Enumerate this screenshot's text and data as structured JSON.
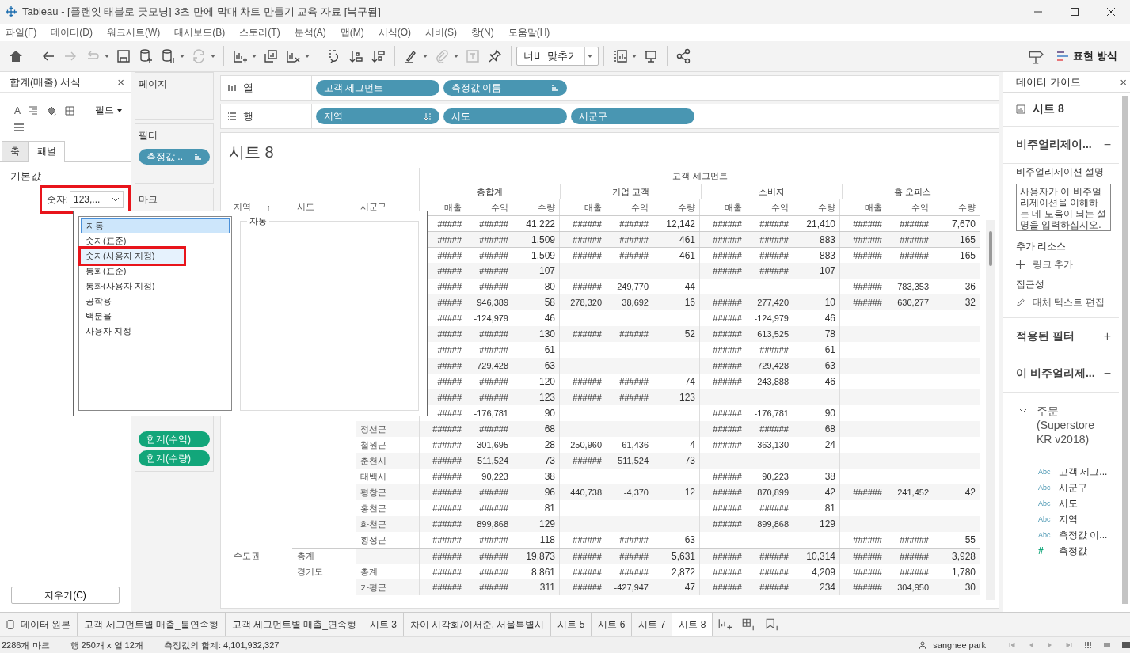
{
  "window": {
    "title": "Tableau - [플랜잇 태블로 굿모닝] 3초 만에 막대 차트 만들기 교육 자료 [복구됨]"
  },
  "menu": [
    "파일(F)",
    "데이터(D)",
    "워크시트(W)",
    "대시보드(B)",
    "스토리(T)",
    "분석(A)",
    "맵(M)",
    "서식(O)",
    "서버(S)",
    "창(N)",
    "도움말(H)"
  ],
  "toolbar": {
    "left": [
      {
        "disabled": false,
        "dropdown": false
      },
      {
        "disabled": false,
        "dropdown": false
      },
      {
        "disabled": true,
        "dropdown": false
      },
      {
        "disabled": true,
        "dropdown": true
      },
      {
        "disabled": false,
        "dropdown": false
      },
      {
        "disabled": false,
        "dropdown": false
      },
      {
        "disabled": false,
        "dropdown": true
      },
      {
        "disabled": true,
        "dropdown": true
      },
      {
        "disabled": false,
        "dropdown": true
      },
      {
        "disabled": false,
        "dropdown": false
      },
      {
        "disabled": false,
        "dropdown": true
      },
      {
        "disabled": false,
        "dropdown": false
      },
      {
        "disabled": false,
        "dropdown": false
      },
      {
        "disabled": false,
        "dropdown": false
      },
      {
        "disabled": false,
        "dropdown": true
      },
      {
        "disabled": true,
        "dropdown": true
      },
      {
        "disabled": true,
        "dropdown": false
      },
      {
        "disabled": false,
        "dropdown": false
      }
    ],
    "fit": "너비 맞추기",
    "right": [
      {
        "disabled": false,
        "dropdown": true
      },
      {
        "disabled": false,
        "dropdown": false
      },
      {
        "disabled": false,
        "dropdown": false
      }
    ],
    "show_me": "표현 방식"
  },
  "format_panel": {
    "title": "합계(매출) 서식",
    "close": "×",
    "font_glyph": "A",
    "field_menu": "필드",
    "tabs": [
      {
        "label": "축",
        "selected": false
      },
      {
        "label": "패널",
        "selected": true
      }
    ],
    "section": "기본값",
    "number_label": "숫자:",
    "number_value": "123,...",
    "number_highlighted": true,
    "clear_button": "지우기(C)"
  },
  "format_popup": {
    "options": [
      {
        "label": "자동",
        "selected": true,
        "hovered": false,
        "highlighted": false
      },
      {
        "label": "숫자(표준)",
        "selected": false,
        "hovered": false,
        "highlighted": false
      },
      {
        "label": "숫자(사용자 지정)",
        "selected": false,
        "hovered": true,
        "highlighted": true
      },
      {
        "label": "통화(표준)",
        "selected": false,
        "hovered": false,
        "highlighted": false
      },
      {
        "label": "통화(사용자 지정)",
        "selected": false,
        "hovered": false,
        "highlighted": false
      },
      {
        "label": "공학용",
        "selected": false,
        "hovered": false,
        "highlighted": false
      },
      {
        "label": "백분율",
        "selected": false,
        "hovered": false,
        "highlighted": false
      },
      {
        "label": "사용자 지정",
        "selected": false,
        "hovered": false,
        "highlighted": false
      }
    ],
    "group_label": "자동"
  },
  "cards": {
    "pages": "페이지",
    "filters": {
      "title": "필터",
      "pills": [
        {
          "label": "측정값 ..",
          "kind": "measure_names"
        }
      ]
    },
    "marks": {
      "title": "마크",
      "pills": [
        {
          "label": "합계(수익)",
          "kind": "measure"
        },
        {
          "label": "합계(수량)",
          "kind": "measure"
        }
      ]
    }
  },
  "shelves": {
    "columns": {
      "label": "열",
      "pills": [
        {
          "label": "고객 세그먼트",
          "kind": "dimension",
          "sorted": false
        },
        {
          "label": "측정값 이름",
          "kind": "measure_names",
          "sorted": false
        }
      ]
    },
    "rows": {
      "label": "행",
      "pills": [
        {
          "label": "지역",
          "kind": "dimension",
          "sorted": true
        },
        {
          "label": "시도",
          "kind": "dimension",
          "sorted": false
        },
        {
          "label": "시군구",
          "kind": "dimension",
          "sorted": false
        }
      ]
    }
  },
  "view": {
    "title": "시트 8",
    "column_field": "고객 세그먼트",
    "row_headers": [
      {
        "label": "지역",
        "sorted": true
      },
      {
        "label": "시도",
        "sorted": false
      },
      {
        "label": "시군구",
        "sorted": false
      }
    ],
    "segments": [
      "총합계",
      "기업 고객",
      "소비자",
      "홈 오피스"
    ],
    "measures": [
      "매출",
      "수익",
      "수량",
      "매출",
      "수익",
      "수량",
      "매출",
      "수익",
      "수량",
      "매출",
      "수익",
      "수량"
    ],
    "rows": [
      {
        "total": true,
        "grand_total": [
          "#####",
          "######",
          "41,222"
        ],
        "corporate": [
          "######",
          "######",
          "12,142"
        ],
        "consumer": [
          "######",
          "######",
          "21,410"
        ],
        "home_office": [
          "######",
          "######",
          "7,670"
        ]
      },
      {
        "total": true,
        "grand_total": [
          "#####",
          "######",
          "1,509"
        ],
        "corporate": [
          "######",
          "######",
          "461"
        ],
        "consumer": [
          "######",
          "######",
          "883"
        ],
        "home_office": [
          "######",
          "######",
          "165"
        ]
      },
      {
        "total": true,
        "grand_total": [
          "#####",
          "######",
          "1,509"
        ],
        "corporate": [
          "######",
          "######",
          "461"
        ],
        "consumer": [
          "######",
          "######",
          "883"
        ],
        "home_office": [
          "######",
          "######",
          "165"
        ]
      },
      {
        "total": false,
        "grand_total": [
          "#####",
          "######",
          "107"
        ],
        "consumer": [
          "######",
          "######",
          "107"
        ]
      },
      {
        "total": false,
        "grand_total": [
          "#####",
          "######",
          "80"
        ],
        "corporate": [
          "######",
          "249,770",
          "44"
        ],
        "home_office": [
          "######",
          "783,353",
          "36"
        ]
      },
      {
        "total": false,
        "grand_total": [
          "#####",
          "946,389",
          "58"
        ],
        "corporate": [
          "278,320",
          "38,692",
          "16"
        ],
        "consumer": [
          "######",
          "277,420",
          "10"
        ],
        "home_office": [
          "######",
          "630,277",
          "32"
        ]
      },
      {
        "total": false,
        "grand_total": [
          "#####",
          "-124,979",
          "46"
        ],
        "consumer": [
          "######",
          "-124,979",
          "46"
        ]
      },
      {
        "total": false,
        "grand_total": [
          "#####",
          "######",
          "130"
        ],
        "corporate": [
          "######",
          "######",
          "52"
        ],
        "consumer": [
          "######",
          "613,525",
          "78"
        ]
      },
      {
        "total": false,
        "grand_total": [
          "#####",
          "######",
          "61"
        ],
        "consumer": [
          "######",
          "######",
          "61"
        ]
      },
      {
        "total": false,
        "grand_total": [
          "#####",
          "729,428",
          "63"
        ],
        "consumer": [
          "######",
          "729,428",
          "63"
        ]
      },
      {
        "total": false,
        "grand_total": [
          "#####",
          "######",
          "120"
        ],
        "corporate": [
          "######",
          "######",
          "74"
        ],
        "consumer": [
          "######",
          "243,888",
          "46"
        ]
      },
      {
        "total": false,
        "grand_total": [
          "#####",
          "######",
          "123"
        ],
        "corporate": [
          "######",
          "######",
          "123"
        ]
      },
      {
        "total": false,
        "grand_total": [
          "#####",
          "-176,781",
          "90"
        ],
        "consumer": [
          "######",
          "-176,781",
          "90"
        ]
      },
      {
        "total": false,
        "district": "정선군",
        "grand_total": [
          "######",
          "######",
          "68"
        ],
        "consumer": [
          "######",
          "######",
          "68"
        ]
      },
      {
        "total": false,
        "district": "철원군",
        "grand_total": [
          "######",
          "301,695",
          "28"
        ],
        "corporate": [
          "250,960",
          "-61,436",
          "4"
        ],
        "consumer": [
          "######",
          "363,130",
          "24"
        ]
      },
      {
        "total": false,
        "district": "춘천시",
        "grand_total": [
          "######",
          "511,524",
          "73"
        ],
        "corporate": [
          "######",
          "511,524",
          "73"
        ]
      },
      {
        "total": false,
        "district": "태백시",
        "grand_total": [
          "######",
          "90,223",
          "38"
        ],
        "consumer": [
          "######",
          "90,223",
          "38"
        ]
      },
      {
        "total": false,
        "district": "평창군",
        "grand_total": [
          "######",
          "######",
          "96"
        ],
        "corporate": [
          "440,738",
          "-4,370",
          "12"
        ],
        "consumer": [
          "######",
          "870,899",
          "42"
        ],
        "home_office": [
          "######",
          "241,452",
          "42"
        ]
      },
      {
        "total": false,
        "district": "홍천군",
        "grand_total": [
          "######",
          "######",
          "81"
        ],
        "consumer": [
          "######",
          "######",
          "81"
        ]
      },
      {
        "total": false,
        "district": "화천군",
        "grand_total": [
          "######",
          "899,868",
          "129"
        ],
        "consumer": [
          "######",
          "899,868",
          "129"
        ]
      },
      {
        "total": false,
        "district": "횡성군",
        "grand_total": [
          "######",
          "######",
          "118"
        ],
        "corporate": [
          "######",
          "######",
          "63"
        ],
        "home_office": [
          "######",
          "######",
          "55"
        ]
      },
      {
        "total": true,
        "region": "수도권",
        "province": "총계",
        "grand_total": [
          "######",
          "######",
          "19,873"
        ],
        "corporate": [
          "######",
          "######",
          "5,631"
        ],
        "consumer": [
          "######",
          "######",
          "10,314"
        ],
        "home_office": [
          "######",
          "######",
          "3,928"
        ]
      },
      {
        "total": true,
        "province": "경기도",
        "district": "총계",
        "grand_total": [
          "######",
          "######",
          "8,861"
        ],
        "corporate": [
          "######",
          "######",
          "2,872"
        ],
        "consumer": [
          "######",
          "######",
          "4,209"
        ],
        "home_office": [
          "######",
          "######",
          "1,780"
        ]
      },
      {
        "total": false,
        "district": "가평군",
        "grand_total": [
          "######",
          "######",
          "311"
        ],
        "corporate": [
          "######",
          "-427,947",
          "47"
        ],
        "consumer": [
          "######",
          "######",
          "234"
        ],
        "home_office": [
          "######",
          "304,950",
          "30"
        ]
      }
    ]
  },
  "data_guide": {
    "title": "데이터 가이드",
    "close": "×",
    "sheet": "시트 8",
    "viz_section": {
      "title": "비주얼리제이...",
      "toggle": "−"
    },
    "desc_label": "비주얼리제이션 설명",
    "desc_placeholder": "사용자가 이 비주얼리제이션을 이해하는 데 도움이 되는 설명을 입력하십시오.",
    "resources_label": "추가 리소스",
    "add_link": "링크 추가",
    "accessibility_label": "접근성",
    "alt_text": "대체 텍스트 편집",
    "filters_section": {
      "title": "적용된 필터",
      "toggle": "+"
    },
    "fields_section": {
      "title": "이 비주얼리제...",
      "toggle": "−"
    },
    "source": {
      "label": "주문 (Superstore KR v2018)",
      "expanded": true,
      "children": [
        {
          "kind": "dimension",
          "type": "Abc",
          "label": "고객 세그..."
        },
        {
          "kind": "dimension",
          "type": "Abc",
          "label": "시군구"
        },
        {
          "kind": "dimension",
          "type": "Abc",
          "label": "시도"
        },
        {
          "kind": "dimension",
          "type": "Abc",
          "label": "지역"
        },
        {
          "kind": "dimension",
          "type": "Abc",
          "label": "측정값 이..."
        },
        {
          "kind": "measure",
          "type": "#",
          "label": "측정값"
        }
      ]
    }
  },
  "sheet_tabs": [
    {
      "label": "데이터 원본",
      "kind": "datasource",
      "selected": false
    },
    {
      "label": "고객 세그먼트별 매출_불연속형",
      "kind": "sheet",
      "selected": false
    },
    {
      "label": "고객 세그먼트별 매출_연속형",
      "kind": "sheet",
      "selected": false
    },
    {
      "label": "시트 3",
      "kind": "sheet",
      "selected": false
    },
    {
      "label": "차이 시각화/이서준, 서울특별시",
      "kind": "sheet",
      "selected": false
    },
    {
      "label": "시트 5",
      "kind": "sheet",
      "selected": false
    },
    {
      "label": "시트 6",
      "kind": "sheet",
      "selected": false
    },
    {
      "label": "시트 7",
      "kind": "sheet",
      "selected": false
    },
    {
      "label": "시트 8",
      "kind": "sheet",
      "selected": true
    }
  ],
  "status": {
    "marks": "2286개 마크",
    "dims": "행 250개 x 열 12개",
    "sum": "측정값의 합계: 4,101,932,327",
    "user": "sanghee park"
  }
}
